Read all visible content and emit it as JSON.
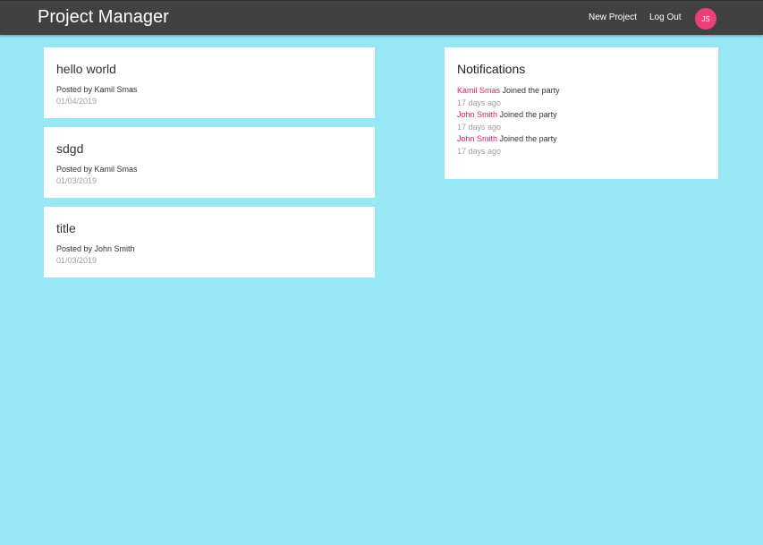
{
  "navbar": {
    "brand": "Project Manager",
    "new_project": "New Project",
    "log_out": "Log Out",
    "avatar_initials": "JS",
    "background_color": "#414141",
    "avatar_color": "#ec407a"
  },
  "page": {
    "background_color": "#98e7f4"
  },
  "projects": [
    {
      "title": "hello world",
      "author": "Posted by Kamil Smas",
      "date": "01/04/2019"
    },
    {
      "title": "sdgd",
      "author": "Posted by Kamil Smas",
      "date": "01/03/2019"
    },
    {
      "title": "title",
      "author": "Posted by John Smith",
      "date": "01/03/2019"
    }
  ],
  "notifications": {
    "title": "Notifications",
    "items": [
      {
        "user": "Kamil Smas",
        "action": "Joined the party",
        "time": "17 days ago"
      },
      {
        "user": "John Smith",
        "action": "Joined the party",
        "time": "17 days ago"
      },
      {
        "user": "John Smith",
        "action": "Joined the party",
        "time": "17 days ago"
      }
    ]
  }
}
